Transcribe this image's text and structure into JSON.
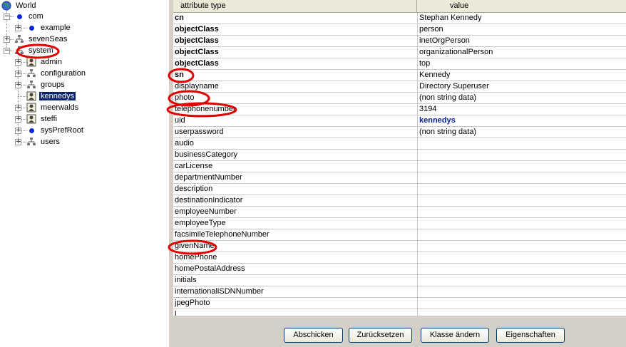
{
  "tree": {
    "root": "World",
    "items": [
      {
        "label": "com"
      },
      {
        "label": "example"
      },
      {
        "label": "sevenSeas"
      },
      {
        "label": "system"
      },
      {
        "label": "admin"
      },
      {
        "label": "configuration"
      },
      {
        "label": "groups"
      },
      {
        "label": "kennedys"
      },
      {
        "label": "meerwalds"
      },
      {
        "label": "steffi"
      },
      {
        "label": "sysPrefRoot"
      },
      {
        "label": "users"
      }
    ]
  },
  "table": {
    "headers": [
      "attribute type",
      "value"
    ],
    "rows": [
      {
        "attr": "cn",
        "value": "Stephan Kennedy",
        "bold": true
      },
      {
        "attr": "objectClass",
        "value": "person",
        "bold": true
      },
      {
        "attr": "objectClass",
        "value": "inetOrgPerson",
        "bold": true
      },
      {
        "attr": "objectClass",
        "value": "organizationalPerson",
        "bold": true
      },
      {
        "attr": "objectClass",
        "value": "top",
        "bold": true
      },
      {
        "attr": "sn",
        "value": "Kennedy",
        "bold": true
      },
      {
        "attr": "displayname",
        "value": "Directory Superuser"
      },
      {
        "attr": "photo",
        "value": "(non string data)"
      },
      {
        "attr": "telephonenumber",
        "value": "3194"
      },
      {
        "attr": "uid",
        "value": "kennedys",
        "valueLink": true
      },
      {
        "attr": "userpassword",
        "value": "(non string data)"
      },
      {
        "attr": "audio",
        "value": ""
      },
      {
        "attr": "businessCategory",
        "value": ""
      },
      {
        "attr": "carLicense",
        "value": ""
      },
      {
        "attr": "departmentNumber",
        "value": ""
      },
      {
        "attr": "description",
        "value": ""
      },
      {
        "attr": "destinationIndicator",
        "value": ""
      },
      {
        "attr": "employeeNumber",
        "value": ""
      },
      {
        "attr": "employeeType",
        "value": ""
      },
      {
        "attr": "facsimileTelephoneNumber",
        "value": ""
      },
      {
        "attr": "givenName",
        "value": ""
      },
      {
        "attr": "homePhone",
        "value": ""
      },
      {
        "attr": "homePostalAddress",
        "value": ""
      },
      {
        "attr": "initials",
        "value": ""
      },
      {
        "attr": "internationaliSDNNumber",
        "value": ""
      },
      {
        "attr": "jpegPhoto",
        "value": ""
      },
      {
        "attr": "l",
        "value": ""
      }
    ]
  },
  "buttons": {
    "submit": "Abschicken",
    "reset": "Zurücksetzen",
    "change_class": "Klasse ändern",
    "properties": "Eigenschaften"
  },
  "colors": {
    "selection": "#0a246a",
    "dot_icon": "#0a24dd",
    "annotation": "#e00000"
  }
}
